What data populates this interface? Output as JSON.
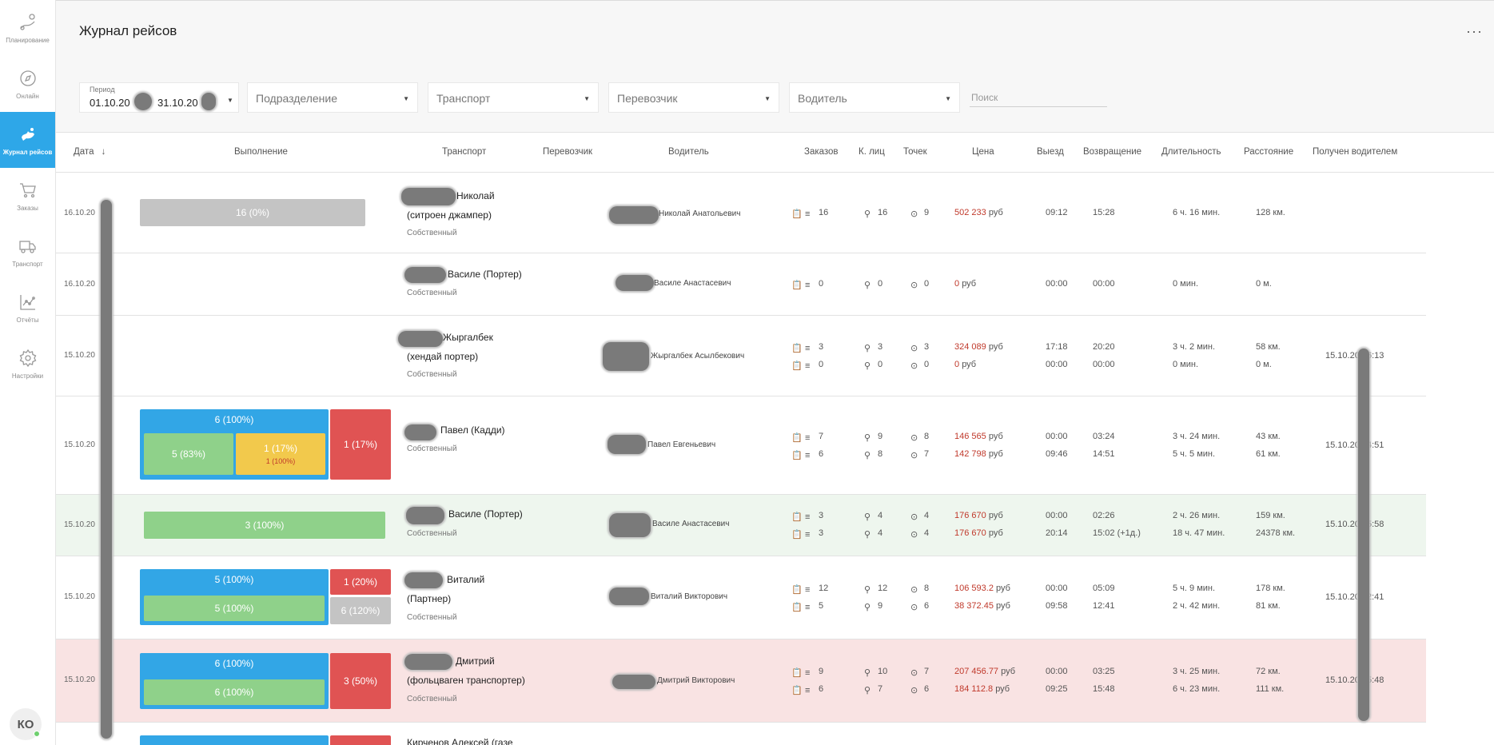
{
  "nav": [
    {
      "label": "Планирование",
      "icon": "planning-icon"
    },
    {
      "label": "Онлайн",
      "icon": "online-icon"
    },
    {
      "label": "Журнал рейсов",
      "icon": "journal-icon",
      "active": true
    },
    {
      "label": "Заказы",
      "icon": "cart-icon"
    },
    {
      "label": "Транспорт",
      "icon": "truck-icon"
    },
    {
      "label": "Отчёты",
      "icon": "chart-icon"
    },
    {
      "label": "Настройки",
      "icon": "gear-icon"
    }
  ],
  "user": {
    "initials": "КО"
  },
  "header": {
    "title": "Журнал рейсов",
    "more": "···"
  },
  "filters": {
    "period_label": "Период",
    "period_from": "01.10.20",
    "period_to": "31.10.20",
    "division": "Подразделение",
    "transport": "Транспорт",
    "carrier": "Перевозчик",
    "driver": "Водитель",
    "search_placeholder": "Поиск"
  },
  "columns": {
    "date": "Дата",
    "execution": "Выполнение",
    "transport": "Транспорт",
    "carrier": "Перевозчик",
    "driver": "Водитель",
    "orders": "Заказов",
    "persons": "К. лиц",
    "points": "Точек",
    "price": "Цена",
    "departure": "Выезд",
    "return": "Возвращение",
    "duration": "Длительность",
    "distance": "Расстояние",
    "received": "Получен водителем"
  },
  "currency": "руб",
  "rows": [
    {
      "date": "16.10.20",
      "vehicle1": "Николай",
      "vehicle2": "(ситроен джампер)",
      "owner": "Собственный",
      "driver": "Николай Анатольевич",
      "bars": {
        "main": "16 (0%)"
      },
      "lines": [
        {
          "orders": "16",
          "persons": "16",
          "points": "9",
          "price": "502 233",
          "dep": "09:12",
          "ret": "15:28",
          "dur": "6 ч. 16 мин.",
          "dist": "128 км."
        }
      ],
      "received": ""
    },
    {
      "date": "16.10.20",
      "vehicle1": "Василе (Портер)",
      "vehicle2": "",
      "owner": "Собственный",
      "driver": "Василе Анастасевич",
      "lines": [
        {
          "orders": "0",
          "persons": "0",
          "points": "0",
          "price": "0",
          "dep": "00:00",
          "ret": "00:00",
          "dur": "0 мин.",
          "dist": "0 м."
        }
      ],
      "received": ""
    },
    {
      "date": "15.10.20",
      "vehicle1": "Жыргалбек",
      "vehicle2": "(хендай портер)",
      "owner": "Собственный",
      "driver": "Жыргалбек Асылбекович",
      "lines": [
        {
          "orders": "3",
          "persons": "3",
          "points": "3",
          "price": "324 089",
          "dep": "17:18",
          "ret": "20:20",
          "dur": "3 ч. 2 мин.",
          "dist": "58 км."
        },
        {
          "orders": "0",
          "persons": "0",
          "points": "0",
          "price": "0",
          "dep": "00:00",
          "ret": "00:00",
          "dur": "0 мин.",
          "dist": "0 м."
        }
      ],
      "received": "15.10.20 16:13"
    },
    {
      "date": "15.10.20",
      "vehicle1": "Павел (Кадди)",
      "vehicle2": "",
      "owner": "Собственный",
      "driver": "Павел Евгеньевич",
      "bars": {
        "blue": "6 (100%)",
        "green": "5 (83%)",
        "yellow": "1 (17%)",
        "yellow_sub": "1 (100%)",
        "red": "1 (17%)"
      },
      "lines": [
        {
          "orders": "7",
          "persons": "9",
          "points": "8",
          "price": "146 565",
          "dep": "00:00",
          "ret": "03:24",
          "dur": "3 ч. 24 мин.",
          "dist": "43 км."
        },
        {
          "orders": "6",
          "persons": "8",
          "points": "7",
          "price": "142 798",
          "dep": "09:46",
          "ret": "14:51",
          "dur": "5 ч. 5 мин.",
          "dist": "61 км."
        }
      ],
      "received": "15.10.20 14:51"
    },
    {
      "date": "15.10.20",
      "vehicle1": "Василе (Портер)",
      "vehicle2": "",
      "owner": "Собственный",
      "driver": "Василе Анастасевич",
      "bars": {
        "green": "3 (100%)"
      },
      "lines": [
        {
          "orders": "3",
          "persons": "4",
          "points": "4",
          "price": "176 670",
          "dep": "00:00",
          "ret": "02:26",
          "dur": "2 ч. 26 мин.",
          "dist": "159 км."
        },
        {
          "orders": "3",
          "persons": "4",
          "points": "4",
          "price": "176 670",
          "dep": "20:14",
          "ret": "15:02 (+1д.)",
          "dur": "18 ч. 47 мин.",
          "dist": "24378 км."
        }
      ],
      "received": "15.10.20 15:58"
    },
    {
      "date": "15.10.20",
      "vehicle1": "Виталий",
      "vehicle2": "(Партнер)",
      "owner": "Собственный",
      "driver": "Виталий Викторович",
      "bars": {
        "blue": "5 (100%)",
        "green": "5 (100%)",
        "red": "1 (20%)",
        "grey": "6 (120%)"
      },
      "lines": [
        {
          "orders": "12",
          "persons": "12",
          "points": "8",
          "price": "106 593.2",
          "dep": "00:00",
          "ret": "05:09",
          "dur": "5 ч. 9 мин.",
          "dist": "178 км."
        },
        {
          "orders": "5",
          "persons": "9",
          "points": "6",
          "price": "38 372.45",
          "dep": "09:58",
          "ret": "12:41",
          "dur": "2 ч. 42 мин.",
          "dist": "81 км."
        }
      ],
      "received": "15.10.20 12:41"
    },
    {
      "date": "15.10.20",
      "vehicle1": "Дмитрий",
      "vehicle2": "(фольцваген транспортер)",
      "owner": "Собственный",
      "driver": "Дмитрий Викторович",
      "bars": {
        "blue": "6 (100%)",
        "green": "6 (100%)",
        "red": "3 (50%)"
      },
      "lines": [
        {
          "orders": "9",
          "persons": "10",
          "points": "7",
          "price": "207 456.77",
          "dep": "00:00",
          "ret": "03:25",
          "dur": "3 ч. 25 мин.",
          "dist": "72 км."
        },
        {
          "orders": "6",
          "persons": "7",
          "points": "6",
          "price": "184 112.8",
          "dep": "09:25",
          "ret": "15:48",
          "dur": "6 ч. 23 мин.",
          "dist": "111 км."
        }
      ],
      "received": "15.10.20 15:48"
    },
    {
      "vehicle1": "Кирченов Алексей (газе"
    }
  ]
}
